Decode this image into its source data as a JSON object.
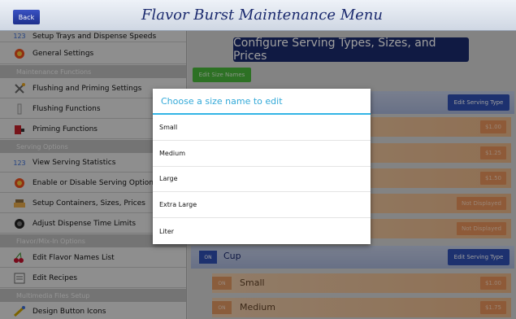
{
  "header": {
    "back_label": "Back",
    "title": "Flavor Burst Maintenance Menu"
  },
  "sidebar": {
    "items": [
      {
        "label": "Setup Trays and Dispense Speeds",
        "icon": "numbers-icon"
      },
      {
        "label": "General Settings",
        "icon": "swirl-icon"
      },
      {
        "header": "Maintenance Functions"
      },
      {
        "label": "Flushing and Priming Settings",
        "icon": "tools-icon"
      },
      {
        "label": "Flushing Functions",
        "icon": "flush-icon"
      },
      {
        "label": "Priming Functions",
        "icon": "pump-icon"
      },
      {
        "header": "Serving Options"
      },
      {
        "label": "View Serving Statistics",
        "icon": "numbers-icon"
      },
      {
        "label": "Enable or Disable Serving Options",
        "icon": "swirl-icon"
      },
      {
        "label": "Setup Containers, Sizes, Prices",
        "icon": "containers-icon"
      },
      {
        "label": "Adjust Dispense Time Limits",
        "icon": "timer-icon"
      },
      {
        "header": "Flavor/Mix-In Options"
      },
      {
        "label": "Edit Flavor Names List",
        "icon": "cherry-icon"
      },
      {
        "label": "Edit Recipes",
        "icon": "recipe-icon"
      },
      {
        "header": "Multimedia Files Setup"
      },
      {
        "label": "Design Button Icons",
        "icon": "paint-icon"
      }
    ]
  },
  "main": {
    "config_title": "Configure Serving Types, Sizes, and Prices",
    "edit_size_names_label": "Edit Size Names",
    "edit_serving_type_label": "Edit Serving Type",
    "first_type_sizes": [
      {
        "price": "$1.00"
      },
      {
        "price": "$1.25"
      },
      {
        "price": "$1.50"
      },
      {
        "price": "Not Displayed"
      },
      {
        "price": "Not Displayed"
      }
    ],
    "cup_type": {
      "on_label": "ON",
      "name": "Cup",
      "edit_label": "Edit Serving Type"
    },
    "cup_sizes": [
      {
        "on_label": "ON",
        "name": "Small",
        "price": "$1.00"
      },
      {
        "on_label": "ON",
        "name": "Medium",
        "price": "$1.75"
      }
    ]
  },
  "dialog": {
    "title": "Choose a size name to edit",
    "options": [
      "Small",
      "Medium",
      "Large",
      "Extra Large",
      "Liter"
    ]
  },
  "colors": {
    "dialog_accent": "#33b5e5",
    "title_blue": "#1a2a6c",
    "edit_green": "#4ab63a",
    "price_orange": "#e88f55"
  }
}
